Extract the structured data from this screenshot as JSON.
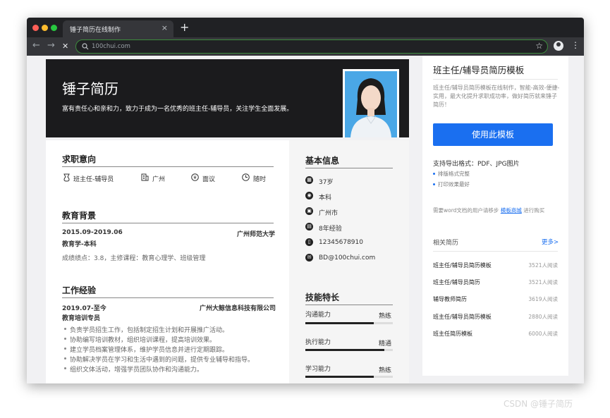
{
  "browser": {
    "tab_title": "锤子简历在线制作",
    "tab_close": "×",
    "new_tab": "+",
    "back": "←",
    "forward": "→",
    "stop": "✕",
    "url": "100chui.com",
    "star": "☆",
    "menu": "⋮"
  },
  "resume": {
    "name": "锤子简历",
    "summary": "富有责任心和亲和力，致力于成为一名优秀的班主任-辅导员，关注学生全面发展。",
    "intent": {
      "title": "求职意向",
      "items": [
        {
          "icon": "position-icon",
          "label": "班主任-辅导员"
        },
        {
          "icon": "building-icon",
          "label": "广州"
        },
        {
          "icon": "salary-icon",
          "label": "面议"
        },
        {
          "icon": "clock-icon",
          "label": "随时"
        }
      ]
    },
    "education": {
      "title": "教育背景",
      "dates": "2015.09-2019.06",
      "school": "广州师范大学",
      "degree": "教育学-本科",
      "detail": "成绩绩点：3.8，主修课程：教育心理学、班级管理"
    },
    "experience": {
      "title": "工作经验",
      "dates": "2019.07-至今",
      "company": "广州大鲸信息科技有限公司",
      "role": "教育培训专员",
      "bullets": [
        "负责学员招生工作，包括制定招生计划和开展推广活动。",
        "协助编写培训教材，组织培训课程，提高培训效果。",
        "建立学员档案管理体系，维护学员信息并进行定期跟踪。",
        "协助解决学员在学习和生活中遇到的问题，提供专业辅导和指导。",
        "组织文体活动，增强学员团队协作和沟通能力。"
      ]
    },
    "basic_info": {
      "title": "基本信息",
      "items": [
        {
          "icon": "calendar-icon",
          "glyph": "▦",
          "value": "37岁"
        },
        {
          "icon": "education-icon",
          "glyph": "◉",
          "value": "本科"
        },
        {
          "icon": "location-icon",
          "glyph": "▣",
          "value": "广州市"
        },
        {
          "icon": "experience-icon",
          "glyph": "▤",
          "value": "8年经验"
        },
        {
          "icon": "phone-icon",
          "glyph": "▯",
          "value": "12345678910"
        },
        {
          "icon": "email-icon",
          "glyph": "✉",
          "value": "BD@100chui.com"
        }
      ]
    },
    "skills": {
      "title": "技能特长",
      "items": [
        {
          "name": "沟通能力",
          "level": "熟练",
          "fraction": 0.78
        },
        {
          "name": "执行能力",
          "level": "精通",
          "fraction": 0.9
        },
        {
          "name": "学习能力",
          "level": "熟练",
          "fraction": 0.78
        }
      ]
    }
  },
  "panel": {
    "title": "班主任/辅导员简历模板",
    "description": "班主任/辅导员简历模板在线制作，智能-高效-便捷-实用，最大化提升求职成功率，做好简历就来锤子简历！",
    "cta": "使用此模板",
    "formats": "支持导出格式：PDF、JPG图片",
    "features": [
      "排版格式完整",
      "打印效果最好"
    ],
    "word_note_prefix": "需要word文档的用户请移步",
    "word_link": "模板商城",
    "word_note_suffix": "进行购买",
    "related_title": "相关简历",
    "more": "更多>",
    "related": [
      {
        "name": "班主任/辅导员简历模板",
        "reads": "3521人阅读"
      },
      {
        "name": "班主任/辅导员简历",
        "reads": "3521人阅读"
      },
      {
        "name": "辅导教师简历",
        "reads": "3619人阅读"
      },
      {
        "name": "班主任/辅导员简历模板",
        "reads": "2880人阅读"
      },
      {
        "name": "班主任简历模板",
        "reads": "6000人阅读"
      }
    ]
  },
  "watermark": "CSDN @锤子简历"
}
